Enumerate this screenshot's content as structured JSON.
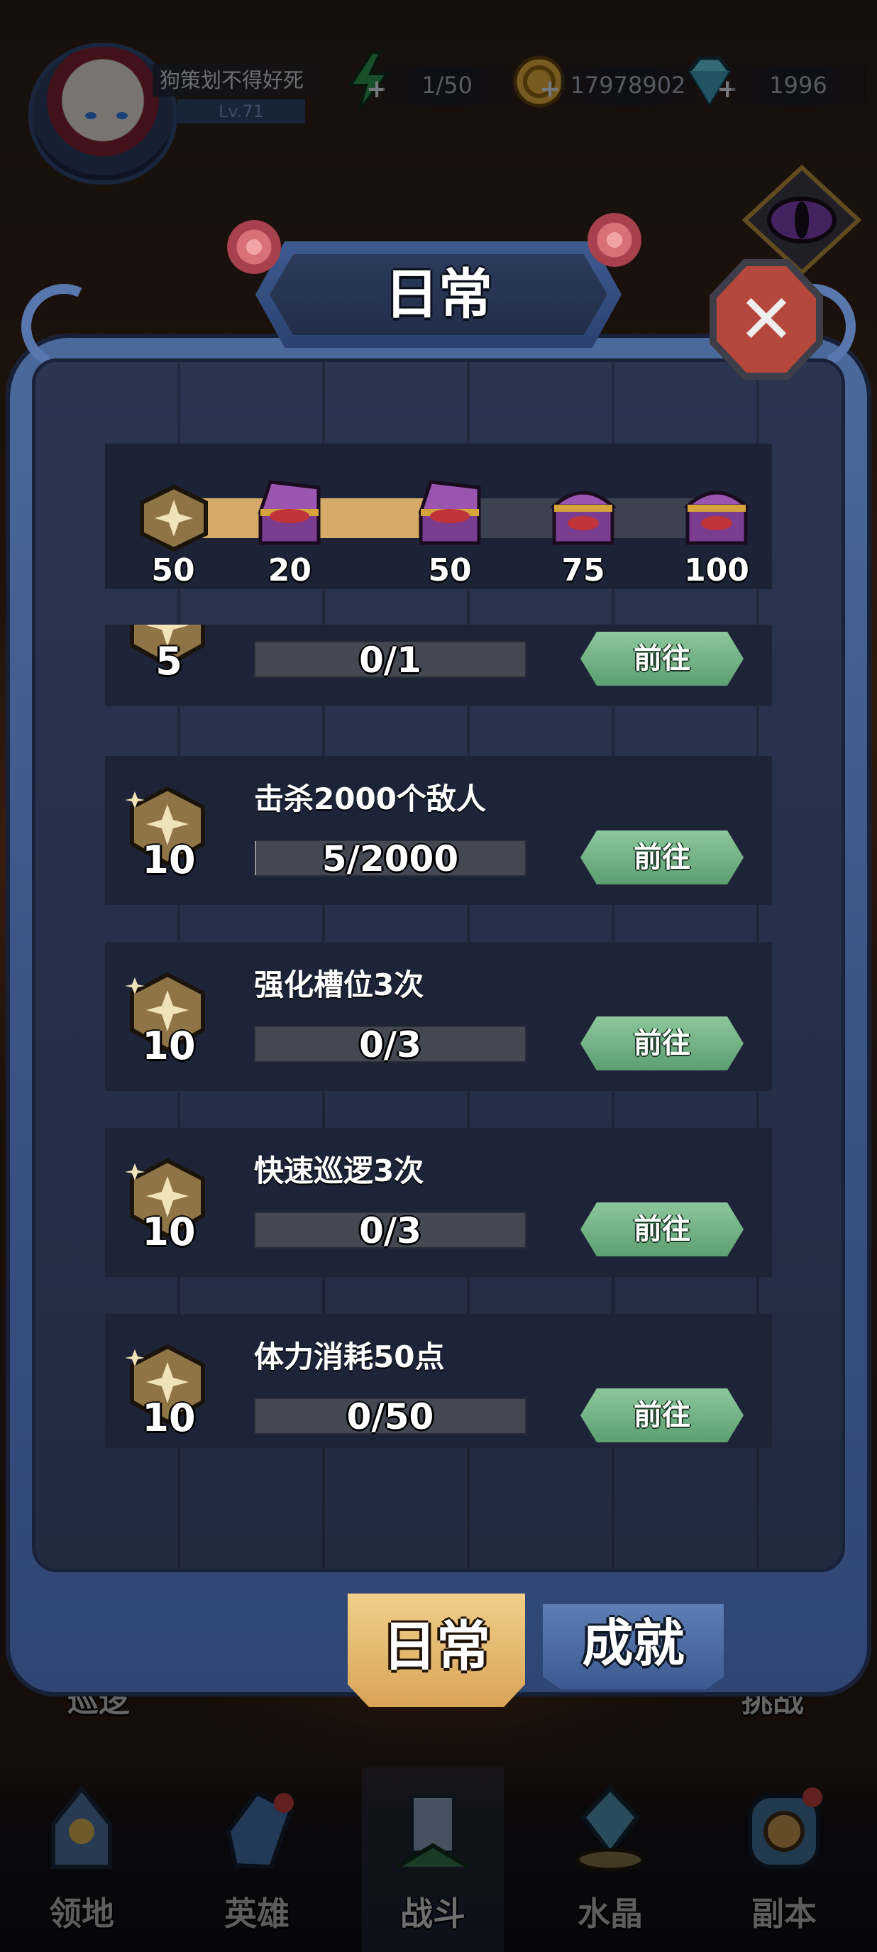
{
  "hud": {
    "player_name": "狗策划不得好死",
    "level": "Lv.71",
    "stamina": "1/50",
    "gold": "17978902",
    "gems": "1996"
  },
  "modal": {
    "title": "日常",
    "progress": {
      "current_points": "50",
      "current_value": 50,
      "max_value": 100,
      "milestones": [
        "20",
        "50",
        "75",
        "100"
      ]
    },
    "tasks": [
      {
        "title": "",
        "reward": "5",
        "progress": "0/1",
        "fraction": 0,
        "action": "前往"
      },
      {
        "title": "击杀2000个敌人",
        "reward": "10",
        "progress": "5/2000",
        "fraction": 0.0025,
        "action": "前往"
      },
      {
        "title": "强化槽位3次",
        "reward": "10",
        "progress": "0/3",
        "fraction": 0,
        "action": "前往"
      },
      {
        "title": "快速巡逻3次",
        "reward": "10",
        "progress": "0/3",
        "fraction": 0,
        "action": "前往"
      },
      {
        "title": "体力消耗50点",
        "reward": "10",
        "progress": "0/50",
        "fraction": 0,
        "action": "前往"
      }
    ],
    "tabs": {
      "daily": "日常",
      "achievement": "成就"
    }
  },
  "scene": {
    "left_label": "巡逻",
    "right_label": "挑战"
  },
  "nav": {
    "items": [
      {
        "label": "领地",
        "icon": "castle-icon"
      },
      {
        "label": "英雄",
        "icon": "hero-icon"
      },
      {
        "label": "战斗",
        "icon": "battle-icon",
        "active": true
      },
      {
        "label": "水晶",
        "icon": "crystal-icon"
      },
      {
        "label": "副本",
        "icon": "dungeon-icon"
      }
    ]
  },
  "colors": {
    "frame": "#4b6a9c",
    "bar_fill": "#d4aa66",
    "go_button": "#6fae80",
    "close_button": "#b6473d",
    "tab_active": "#e6bb70",
    "tab_inactive": "#4b6ca2"
  }
}
